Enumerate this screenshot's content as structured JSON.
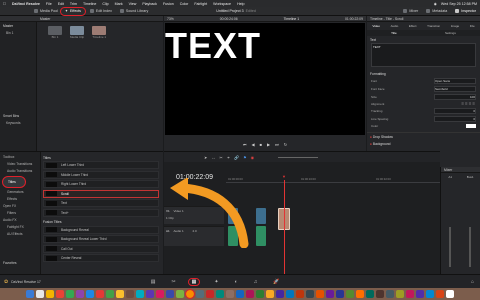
{
  "menubar": {
    "app": "DaVinci Resolve",
    "items": [
      "File",
      "Edit",
      "Trim",
      "Timeline",
      "Clip",
      "Mark",
      "View",
      "Playback",
      "Fusion",
      "Color",
      "Fairlight",
      "Workspace",
      "Help"
    ],
    "clock": "Wed Sep 25  12:58 PM"
  },
  "topbar": {
    "media_pool": "Media Pool",
    "effects": "Effects",
    "edit_index": "Edit Index",
    "sound_library": "Sound Library",
    "project": "Untitled Project 3",
    "edited": "Edited",
    "mixer": "Mixer",
    "metadata": "Metadata",
    "inspector": "Inspector"
  },
  "media": {
    "header": "Master",
    "sidebar": [
      "Master",
      "Bin 1"
    ],
    "smart_bins": "Smart Bins",
    "keywords": "Keywords",
    "clips": [
      {
        "name": "Bin 1",
        "color": "#5b5e63"
      },
      {
        "name": "Media Clip",
        "color": "#7b8b9b"
      },
      {
        "name": "Timeline 1",
        "color": "#9d7c74"
      }
    ]
  },
  "effects": {
    "tree": [
      "Toolbox",
      "Video Transitions",
      "Audio Transitions",
      "Titles",
      "Generators",
      "Effects",
      "Open FX",
      "Filters",
      "Audio FX",
      "Fairlight FX",
      "AU Effects",
      "Favorites"
    ],
    "selected": "Titles",
    "section_titles": "Titles",
    "titles": [
      "Left Lower Third",
      "Middle Lower Third",
      "Right Lower Third",
      "Scroll",
      "Text",
      "Text+"
    ],
    "selected_title": "Scroll",
    "section_fusion": "Fusion Titles",
    "fusion_titles": [
      "Background Reveal",
      "Background Reveal Lower Third",
      "Call Out",
      "Center Reveal"
    ]
  },
  "viewer": {
    "zoom": "73%",
    "timecode_left": "00:00:24:06",
    "timeline_name": "Timeline 1",
    "timecode_right": "01:00:22:09",
    "text": "TEXT"
  },
  "timeline": {
    "timecode": "01:00:22:09",
    "ruler": [
      "01:00:00:00",
      "01:00:16:00",
      "01:00:32:00"
    ],
    "tracks": [
      {
        "id": "V1",
        "name": "Video 1",
        "info": "1 Clip"
      },
      {
        "id": "A1",
        "name": "Audio 1",
        "info": "2.0"
      }
    ],
    "colors": {
      "video": "#3d6f8f",
      "audio": "#2f8f63",
      "title": "#b98a72",
      "playhead": "#e23434"
    }
  },
  "inspector": {
    "header": "Timeline - Title - Scroll",
    "tabs": [
      "Video",
      "Audio",
      "Effect",
      "Transition",
      "Image",
      "File"
    ],
    "subtabs": [
      "Title",
      "Settings"
    ],
    "text_label": "Text",
    "text_value": "TEXT",
    "formatting": "Formatting",
    "rows": [
      {
        "label": "Font",
        "value": "Open Sans"
      },
      {
        "label": "Font Face",
        "value": "Semibold"
      },
      {
        "label": "Size",
        "value": "100"
      },
      {
        "label": "Alignment",
        "value": ""
      },
      {
        "label": "Tracking",
        "value": "0"
      },
      {
        "label": "Line Spacing",
        "value": "0"
      },
      {
        "label": "Color",
        "value": ""
      }
    ],
    "drop_shadow": "Drop Shadow",
    "background": "Background"
  },
  "mixer": {
    "header": "Mixer",
    "channels": [
      "A1",
      "Bus1"
    ]
  },
  "bottom": {
    "app_label": "DaVinci Resolve 17"
  },
  "dock_colors": [
    "#3a7bd5",
    "#e8e8e8",
    "#f4b400",
    "#ea4335",
    "#34a853",
    "#8e44ad",
    "#1e88e5",
    "#e53935",
    "#43a047",
    "#fbc02d",
    "#6d4c41",
    "#00acc1",
    "#5e35b1",
    "#d81b60",
    "#3949ab",
    "#7cb342",
    "#fb8c00",
    "#546e7a",
    "#c62828",
    "#00897b",
    "#8d6e63",
    "#1565c0",
    "#ad1457",
    "#2e7d32",
    "#f9a825",
    "#4527a0",
    "#0277bd",
    "#bf360c",
    "#37474f",
    "#e65100",
    "#6a1b9a",
    "#283593",
    "#558b2f",
    "#ff6f00",
    "#00695c",
    "#4e342e",
    "#455a64",
    "#9e9d24",
    "#c2185b",
    "#512da8",
    "#0288d1",
    "#d84315",
    "#ffffff"
  ]
}
